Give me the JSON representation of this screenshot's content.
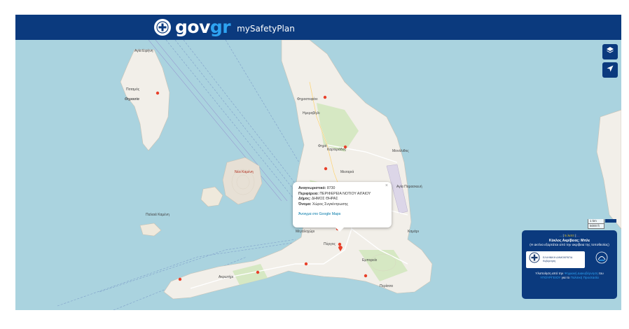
{
  "header": {
    "logo_main": "gov",
    "logo_accent": "gr",
    "app_name": "mySafetyPlan"
  },
  "map": {
    "labels": [
      "Αγία Ειρήνη",
      "Ποταμός",
      "Θηρασία",
      "Φηρά",
      "Φηροστεφάνι",
      "Ημεροβίγλι",
      "Καρτεράδος",
      "Μεσαριά",
      "Μονόλιθος",
      "Νέα Καμένη",
      "Αγία Παρασκευή",
      "Μεγαλοχώρι",
      "Καμάρι",
      "Πύργος",
      "Εμπορείο",
      "Περίσσα",
      "Ακρωτήρι",
      "Παλαιά Καμένη"
    ],
    "controls": {
      "layers_icon": "layers-icon",
      "locate_icon": "locate-icon"
    },
    "scale": {
      "metric": "1 km",
      "imperial": "5000 ft"
    }
  },
  "popup": {
    "close": "×",
    "id_label": "Αναγνωριστικό:",
    "id_value": "8730",
    "region_label": "Περιφέρεια:",
    "region_value": "ΠΕΡΙΦΕΡΕΙΑ ΝΟΤΙΟΥ ΑΙΓΑΙΟΥ",
    "municipality_label": "Δήμος:",
    "municipality_value": "ΔΗΜΟΣ ΘΗΡΑΣ",
    "name_label": "Όνομα:",
    "name_value": "Χώρος Συγκέντρωσης",
    "gmaps_link": "Άνοιγμα στο Google Maps"
  },
  "info_panel": {
    "status_left": "...",
    "status_sep1": " | ",
    "status_mid": "5 λεπτ",
    "status_sep2": " | ",
    "status_right": "...",
    "accuracy": "Κύκλος Ακρίβειας: Μπλε",
    "note": "(Η ακτίνα εξαρτάται από την ακρίβεια της τοποθεσίας)",
    "hd_name": "ΕΛΛΗΝΙΚΗ ΔΗΜΟΚΡΑΤΙΑ",
    "hd_sub": "Κυβέρνηση",
    "support_prefix": "Υλοποίηση από την",
    "support_link1": "Ψηφιακή Διακυβέρνηση",
    "support_mid": "του",
    "support_link2": "ΥΠΟΥΡΓΕΙΟΥ",
    "support_suffix": "για το",
    "support_link3": "Πολιτική Προστασία"
  },
  "colors": {
    "brand": "#0b3a7e",
    "accent": "#2ea3f2",
    "sea": "#aad3df",
    "land": "#f2efe9",
    "poi": "#e8402a"
  }
}
